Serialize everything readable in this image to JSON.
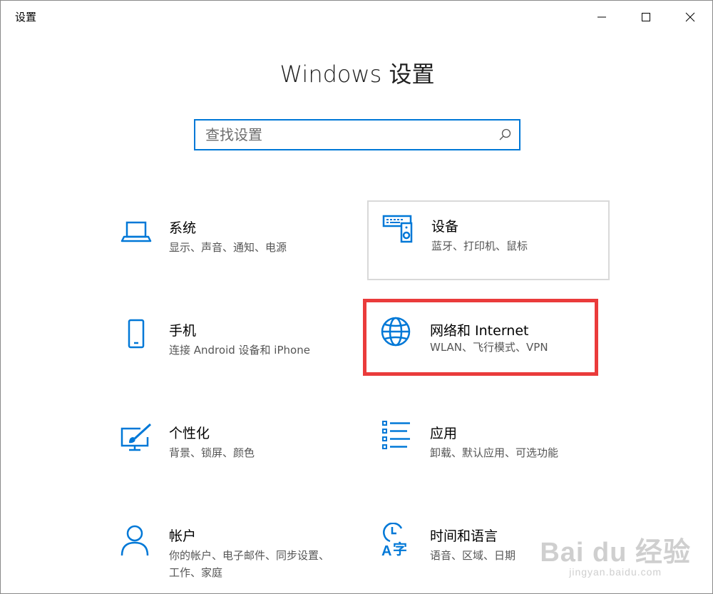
{
  "window": {
    "title": "设置"
  },
  "header": {
    "title": "Windows 设置"
  },
  "search": {
    "placeholder": "查找设置",
    "value": ""
  },
  "tiles": [
    {
      "title": "系统",
      "desc": "显示、声音、通知、电源",
      "icon": "laptop-icon"
    },
    {
      "title": "设备",
      "desc": "蓝牙、打印机、鼠标",
      "icon": "keyboard-speaker-icon"
    },
    {
      "title": "手机",
      "desc": "连接 Android 设备和 iPhone",
      "icon": "phone-icon"
    },
    {
      "title": "网络和 Internet",
      "desc": "WLAN、飞行模式、VPN",
      "icon": "globe-icon"
    },
    {
      "title": "个性化",
      "desc": "背景、锁屏、颜色",
      "icon": "paint-monitor-icon"
    },
    {
      "title": "应用",
      "desc": "卸载、默认应用、可选功能",
      "icon": "app-list-icon"
    },
    {
      "title": "帐户",
      "desc": "你的帐户、电子邮件、同步设置、工作、家庭",
      "icon": "person-icon"
    },
    {
      "title": "时间和语言",
      "desc": "语音、区域、日期",
      "icon": "clock-language-icon"
    }
  ],
  "colors": {
    "accent": "#0078d7",
    "highlight": "#ea3b3b"
  },
  "watermark": {
    "brand": "Bai du 经验",
    "url": "jingyan.baidu.com"
  }
}
